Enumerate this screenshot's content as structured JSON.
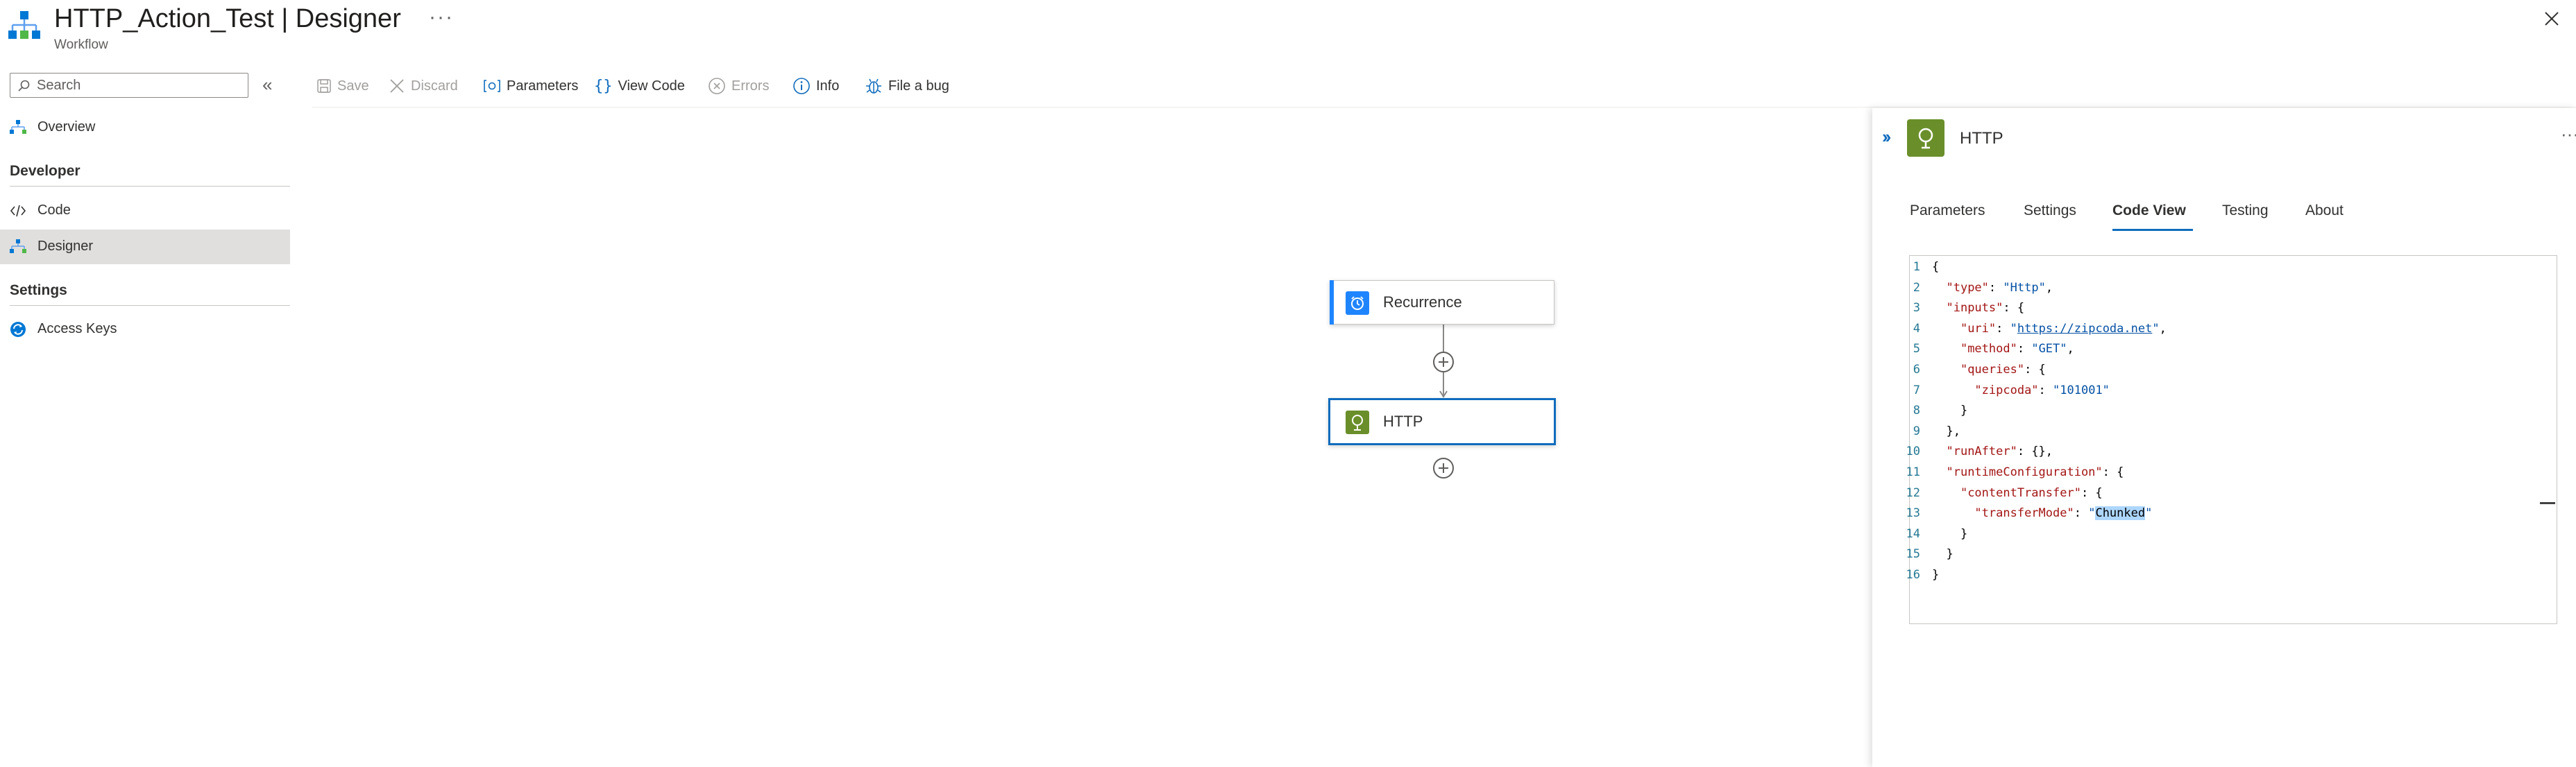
{
  "header": {
    "title": "HTTP_Action_Test | Designer",
    "more": "···",
    "subtitle": "Workflow"
  },
  "sidebar": {
    "search_placeholder": "Search",
    "collapse": "«",
    "items": [
      {
        "label": "Overview"
      },
      {
        "label": "Code"
      },
      {
        "label": "Designer"
      },
      {
        "label": "Access Keys"
      }
    ],
    "sections": {
      "developer": "Developer",
      "settings": "Settings"
    }
  },
  "toolbar": {
    "save": "Save",
    "discard": "Discard",
    "parameters": "Parameters",
    "view_code": "View Code",
    "errors": "Errors",
    "info": "Info",
    "file_bug": "File a bug"
  },
  "canvas": {
    "nodes": [
      {
        "label": "Recurrence",
        "color": "#1f85ff"
      },
      {
        "label": "HTTP",
        "color": "#6a8f2a"
      }
    ]
  },
  "panel": {
    "title": "HTTP",
    "more": "···",
    "tabs": [
      {
        "label": "Parameters"
      },
      {
        "label": "Settings"
      },
      {
        "label": "Code View",
        "selected": true
      },
      {
        "label": "Testing"
      },
      {
        "label": "About"
      }
    ]
  },
  "code": {
    "lines": [
      {
        "n": "1",
        "tokens": [
          [
            "p",
            "{"
          ]
        ]
      },
      {
        "n": "2",
        "tokens": [
          [
            "p",
            "  "
          ],
          [
            "k",
            "\"type\""
          ],
          [
            "p",
            ": "
          ],
          [
            "s",
            "\"Http\""
          ],
          [
            "p",
            ","
          ]
        ]
      },
      {
        "n": "3",
        "tokens": [
          [
            "p",
            "  "
          ],
          [
            "k",
            "\"inputs\""
          ],
          [
            "p",
            ": {"
          ]
        ]
      },
      {
        "n": "4",
        "tokens": [
          [
            "p",
            "    "
          ],
          [
            "k",
            "\"uri\""
          ],
          [
            "p",
            ": "
          ],
          [
            "s",
            "\""
          ],
          [
            "u",
            "https://zipcoda.net"
          ],
          [
            "s",
            "\""
          ],
          [
            "p",
            ","
          ]
        ]
      },
      {
        "n": "5",
        "tokens": [
          [
            "p",
            "    "
          ],
          [
            "k",
            "\"method\""
          ],
          [
            "p",
            ": "
          ],
          [
            "s",
            "\"GET\""
          ],
          [
            "p",
            ","
          ]
        ]
      },
      {
        "n": "6",
        "tokens": [
          [
            "p",
            "    "
          ],
          [
            "k",
            "\"queries\""
          ],
          [
            "p",
            ": {"
          ]
        ]
      },
      {
        "n": "7",
        "tokens": [
          [
            "p",
            "      "
          ],
          [
            "k",
            "\"zipcoda\""
          ],
          [
            "p",
            ": "
          ],
          [
            "s",
            "\"101001\""
          ]
        ]
      },
      {
        "n": "8",
        "tokens": [
          [
            "p",
            "    }"
          ]
        ]
      },
      {
        "n": "9",
        "tokens": [
          [
            "p",
            "  },"
          ]
        ]
      },
      {
        "n": "10",
        "tokens": [
          [
            "p",
            "  "
          ],
          [
            "k",
            "\"runAfter\""
          ],
          [
            "p",
            ": {},"
          ]
        ]
      },
      {
        "n": "11",
        "tokens": [
          [
            "p",
            "  "
          ],
          [
            "k",
            "\"runtimeConfiguration\""
          ],
          [
            "p",
            ": {"
          ]
        ]
      },
      {
        "n": "12",
        "tokens": [
          [
            "p",
            "    "
          ],
          [
            "k",
            "\"contentTransfer\""
          ],
          [
            "p",
            ": {"
          ]
        ]
      },
      {
        "n": "13",
        "tokens": [
          [
            "p",
            "      "
          ],
          [
            "k",
            "\"transferMode\""
          ],
          [
            "p",
            ": "
          ],
          [
            "s",
            "\""
          ],
          [
            "hl",
            "Chunked"
          ],
          [
            "s",
            "\""
          ]
        ]
      },
      {
        "n": "14",
        "tokens": [
          [
            "p",
            "    }"
          ]
        ]
      },
      {
        "n": "15",
        "tokens": [
          [
            "p",
            "  }"
          ]
        ]
      },
      {
        "n": "16",
        "tokens": [
          [
            "p",
            "}"
          ]
        ]
      }
    ]
  },
  "colors": {
    "accent": "#0f6cbd",
    "http_icon": "#6a8f2a",
    "recurrence_icon": "#1f85ff"
  }
}
